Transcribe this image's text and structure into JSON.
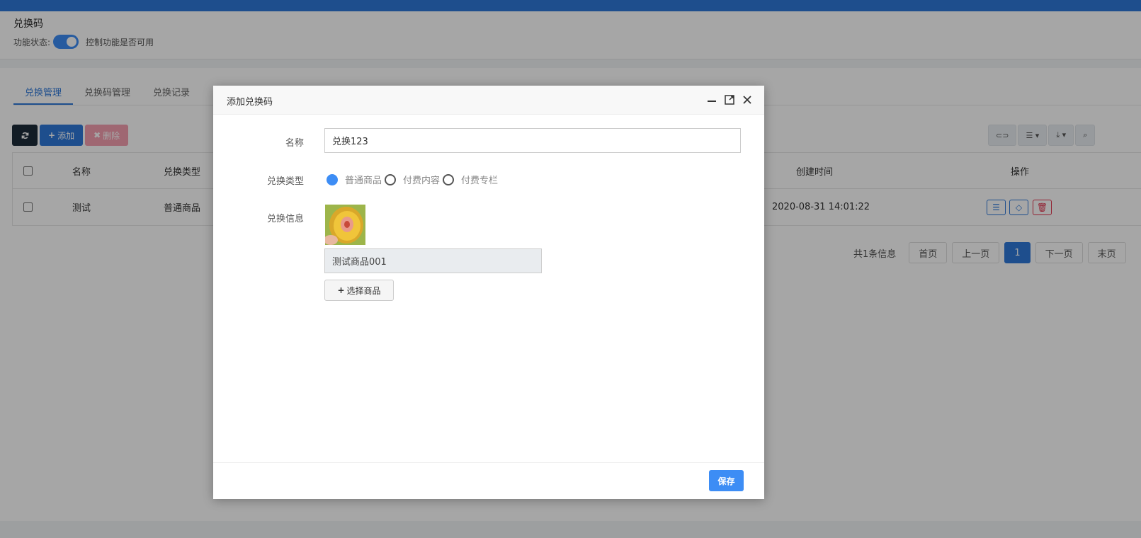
{
  "page": {
    "title": "兑换码",
    "status_label": "功能状态:",
    "status_desc": "控制功能是否可用"
  },
  "tabs": [
    {
      "label": "兑换管理",
      "active": true
    },
    {
      "label": "兑换码管理",
      "active": false
    },
    {
      "label": "兑换记录",
      "active": false
    }
  ],
  "toolbar": {
    "add_label": "添加",
    "delete_label": "删除"
  },
  "table": {
    "headers": {
      "name": "名称",
      "type": "兑换类型",
      "created": "创建时间",
      "ops": "操作"
    },
    "rows": [
      {
        "name": "测试",
        "type": "普通商品",
        "created": "2020-08-31 14:01:22"
      }
    ]
  },
  "pager": {
    "info": "共1条信息",
    "first": "首页",
    "prev": "上一页",
    "current": "1",
    "next": "下一页",
    "last": "末页"
  },
  "modal": {
    "title": "添加兑换码",
    "name_label": "名称",
    "name_value": "兑换123",
    "type_label": "兑换类型",
    "type_options": [
      "普通商品",
      "付费内容",
      "付费专栏"
    ],
    "type_selected": 0,
    "info_label": "兑换信息",
    "goods_name": "测试商品001",
    "select_goods_label": "选择商品",
    "save_label": "保存"
  },
  "colors": {
    "primary": "#2f79d9",
    "accent": "#3d8df5",
    "danger": "#e0334d"
  }
}
